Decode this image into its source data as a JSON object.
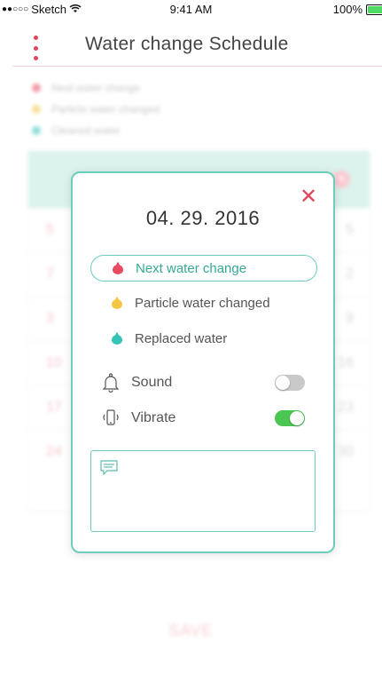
{
  "status_bar": {
    "signal": "●●○○○",
    "carrier": "Sketch",
    "wifi_icon": "wifi-icon",
    "time": "9:41 AM",
    "battery": "100%"
  },
  "header": {
    "title": "Water change Schedule",
    "menu_icon": "vertical-dots-icon"
  },
  "background": {
    "legend": [
      {
        "label": "Next water change",
        "color": "#e84a5f"
      },
      {
        "label": "Particle water changed",
        "color": "#f2c744"
      },
      {
        "label": "Cleaned water",
        "color": "#38c3b7"
      }
    ],
    "calendar_rows": [
      {
        "left": "5",
        "right": "5"
      },
      {
        "left": "7",
        "right": "2"
      },
      {
        "left": "3",
        "right": "9"
      },
      {
        "left": "10",
        "right": "16"
      },
      {
        "left": "17",
        "right": "23"
      },
      {
        "left": "24",
        "right": "30"
      }
    ],
    "save_label": "SAVE"
  },
  "modal": {
    "date": "04. 29. 2016",
    "close_icon": "close-icon",
    "options": [
      {
        "label": "Next water change",
        "color": "#e84a5f",
        "selected": true
      },
      {
        "label": "Particle water changed",
        "color": "#f2c744",
        "selected": false
      },
      {
        "label": "Replaced water",
        "color": "#38c3b7",
        "selected": false
      }
    ],
    "sound": {
      "label": "Sound",
      "on": false,
      "icon": "bell-icon"
    },
    "vibrate": {
      "label": "Vibrate",
      "on": true,
      "icon": "phone-vibrate-icon"
    },
    "note_icon": "message-icon"
  }
}
